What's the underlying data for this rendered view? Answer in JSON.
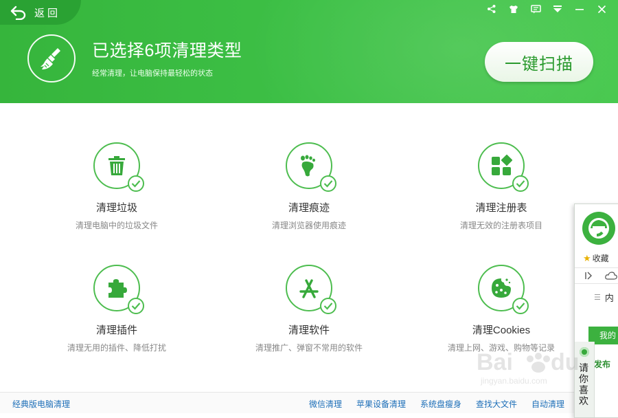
{
  "header": {
    "back_label": "返回",
    "title": "已选择6项清理类型",
    "subtitle": "经常清理，让电脑保持最轻松的状态",
    "scan_button": "一键扫描",
    "titlebar_icons": [
      "share-icon",
      "skin-icon",
      "message-icon",
      "menu-icon",
      "minimize-icon",
      "close-icon"
    ]
  },
  "tiles": [
    {
      "title": "清理垃圾",
      "desc": "清理电脑中的垃圾文件",
      "icon": "trash-icon",
      "checked": true
    },
    {
      "title": "清理痕迹",
      "desc": "清理浏览器使用痕迹",
      "icon": "footprint-icon",
      "checked": true
    },
    {
      "title": "清理注册表",
      "desc": "清理无效的注册表项目",
      "icon": "registry-icon",
      "checked": true
    },
    {
      "title": "清理插件",
      "desc": "清理无用的插件、降低打扰",
      "icon": "puzzle-icon",
      "checked": true
    },
    {
      "title": "清理软件",
      "desc": "清理推广、弹窗不常用的软件",
      "icon": "app-store-icon",
      "checked": true
    },
    {
      "title": "清理Cookies",
      "desc": "清理上网、游戏、购物等记录",
      "icon": "cookie-icon",
      "checked": true
    }
  ],
  "footer": {
    "classic_link": "经典版电脑清理",
    "links": [
      "微信清理",
      "苹果设备清理",
      "系统盘瘦身",
      "查找大文件",
      "自动清理"
    ]
  },
  "side_panel": {
    "favorites_label": "收藏",
    "memory_label": "内",
    "my_button": "我的",
    "publish_label": "发布",
    "vertical_tab": "请你喜欢"
  },
  "colors": {
    "header_green": "#3dc046",
    "accent_green": "#4dbd4f",
    "link_blue": "#1d6fb8"
  }
}
